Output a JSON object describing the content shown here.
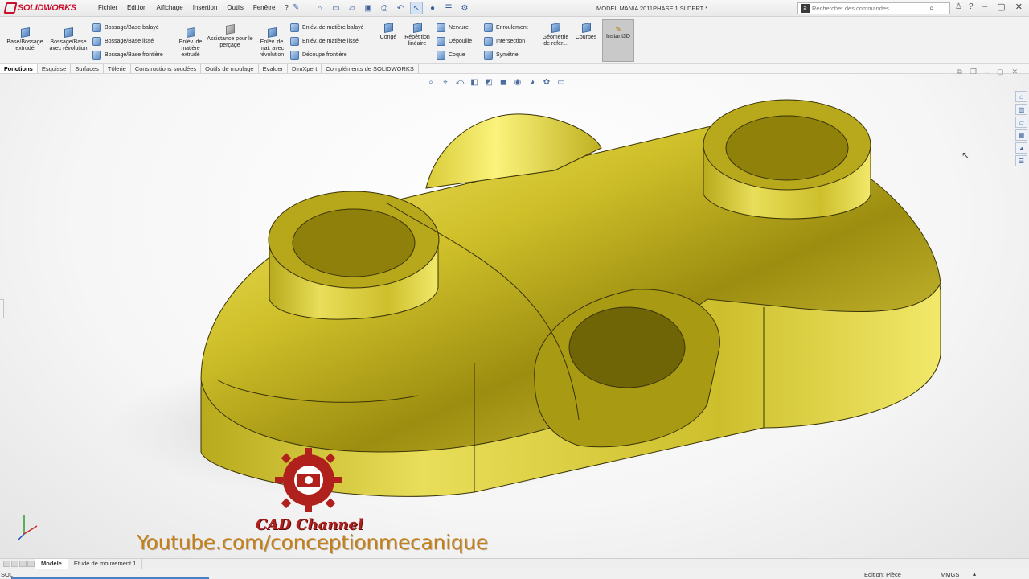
{
  "app": {
    "brand": "SOLIDWORKS"
  },
  "menu": [
    "Fichier",
    "Edition",
    "Affichage",
    "Insertion",
    "Outils",
    "Fenêtre",
    "?"
  ],
  "document_title": "MODEL MANIA 2011PHASE 1.SLDPRT *",
  "search": {
    "placeholder": "Rechercher des commandes"
  },
  "ribbon": {
    "extrude": "Base/Bossage extrudé",
    "revolve": "Bossage/Base avec révolution",
    "swept": "Bossage/Base balayé",
    "loft": "Bossage/Base lissé",
    "boundary": "Bossage/Base frontière",
    "cut_extrude": "Enlév. de matière extrudé",
    "hole_wizard": "Assistance pour le perçage",
    "cut_revolve": "Enlév. de mat. avec révolution",
    "cut_swept": "Enlév. de matière balayé",
    "cut_loft": "Enlév. de matière lissé",
    "cut_boundary": "Découpe frontière",
    "fillet": "Congé",
    "pattern": "Répétition linéaire",
    "rib": "Nervure",
    "draft": "Dépouille",
    "shell": "Coque",
    "wrap": "Enroulement",
    "intersect": "Intersection",
    "mirror": "Symétrie",
    "ref_geom": "Géométrie de référ...",
    "curves": "Courbes",
    "instant3d": "Instant3D"
  },
  "tabs": [
    "Fonctions",
    "Esquisse",
    "Surfaces",
    "Tôlerie",
    "Constructions soudées",
    "Outils de moulage",
    "Evaluer",
    "DimXpert",
    "Compléments de SOLIDWORKS"
  ],
  "bottom_tabs": [
    "Modèle",
    "Etude de mouvement 1"
  ],
  "status": {
    "left": "SOL",
    "edition": "Edition: Pièce",
    "units": "MMGS"
  },
  "overlay": {
    "channel": "CAD Channel",
    "youtube": "Youtube.com/conceptionmecanique"
  },
  "colors": {
    "part": "#d4c62e",
    "accent": "#c8102e",
    "overlay_red": "#b0201d",
    "overlay_orange": "#c2801c"
  }
}
